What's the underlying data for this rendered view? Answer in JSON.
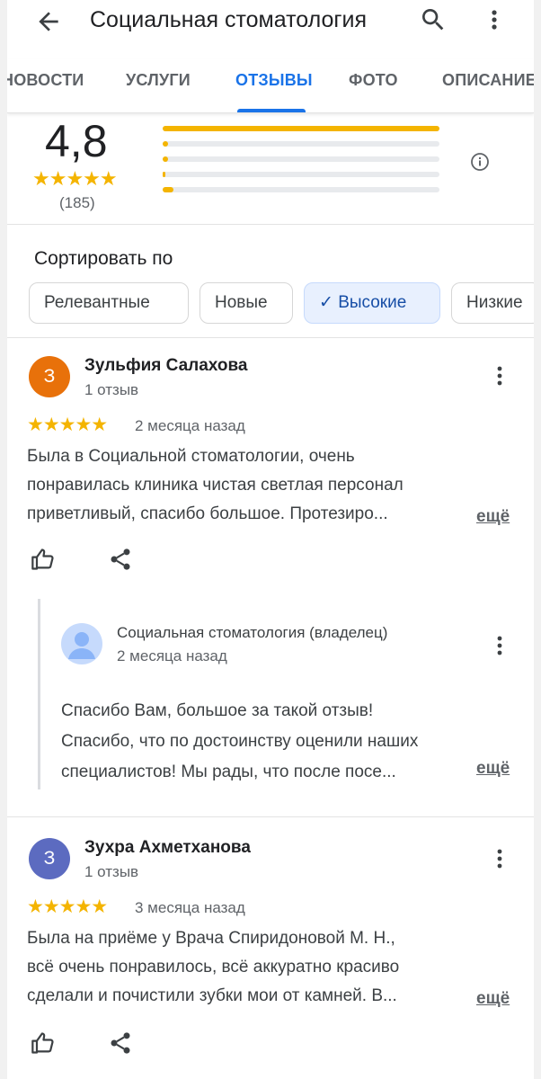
{
  "appbar": {
    "title": "Социальная стоматология",
    "back_icon": "arrow-back-icon",
    "search_icon": "search-icon",
    "more_icon": "more-vert-icon"
  },
  "tabs": [
    {
      "label": "НОВОСТИ",
      "active": false
    },
    {
      "label": "УСЛУГИ",
      "active": false
    },
    {
      "label": "ОТЗЫВЫ",
      "active": true
    },
    {
      "label": "ФОТО",
      "active": false
    },
    {
      "label": "ОПИСАНИЕ",
      "active": false
    }
  ],
  "rating": {
    "value": "4,8",
    "stars": "★★★★★",
    "count": "(185)",
    "distribution": [
      {
        "stars": 5,
        "fraction": 1.0
      },
      {
        "stars": 4,
        "fraction": 0.02
      },
      {
        "stars": 3,
        "fraction": 0.02
      },
      {
        "stars": 2,
        "fraction": 0.01
      },
      {
        "stars": 1,
        "fraction": 0.04
      }
    ]
  },
  "sort": {
    "title": "Сортировать по",
    "chips": [
      {
        "label": "Релевантные",
        "selected": false
      },
      {
        "label": "Новые",
        "selected": false
      },
      {
        "label": "✓ Высокие",
        "selected": true
      },
      {
        "label": "Низкие",
        "selected": false
      }
    ]
  },
  "reviews": [
    {
      "initial": "З",
      "avatar_color": "#e8710a",
      "name": "Зульфия Салахова",
      "meta": "1 отзыв",
      "stars": "★★★★★",
      "date": "2 месяца назад",
      "text": [
        "Была в Социальной стоматологии, очень",
        "понравилась клиника чистая светлая персонал",
        "приветливый,  спасибо большое. Протезиро..."
      ],
      "more": "ещё",
      "reply": {
        "owner": "Социальная стоматология (владелец)",
        "date": "2 месяца назад",
        "text": [
          "Спасибо Вам, большое за такой отзыв!",
          "Спасибо, что по достоинству оценили наших",
          "специалистов!  Мы рады, что после посе..."
        ],
        "more": "ещё"
      }
    },
    {
      "initial": "З",
      "avatar_color": "#5c6bc0",
      "name": "Зухра Ахметханова",
      "meta": "1 отзыв",
      "stars": "★★★★★",
      "date": "3 месяца назад",
      "text": [
        "Была на приёме у Врача Спиридоновой М. Н.,",
        "всё очень понравилось, всё аккуратно красиво",
        "сделали и почистили зубки мои от камней. В..."
      ],
      "more": "ещё"
    }
  ],
  "colors": {
    "accent": "#1a73e8",
    "star": "#f4b400",
    "selected_chip_bg": "#e8f0fe"
  }
}
